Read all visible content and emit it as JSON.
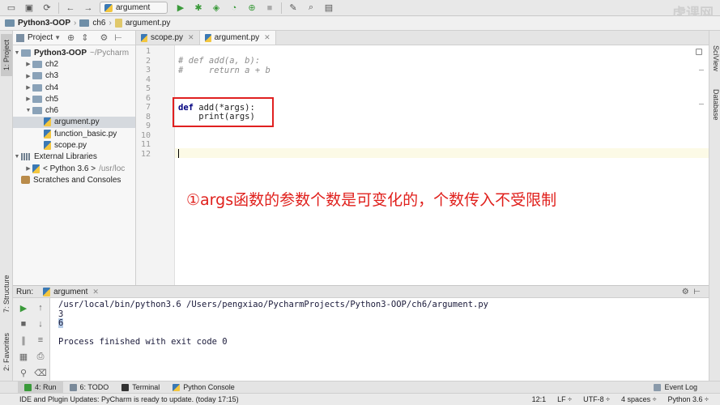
{
  "toolbar": {
    "run_config": "argument",
    "watermark": "虎课网"
  },
  "breadcrumb": [
    "Python3-OOP",
    "ch6",
    "argument.py"
  ],
  "left_strip": {
    "project_tab": "1: Project",
    "structure_tab": "7: Structure",
    "favorites_tab": "2: Favorites"
  },
  "right_strip": {
    "sciview_tab": "SciView",
    "database_tab": "Database"
  },
  "project_panel": {
    "header": "Project",
    "root_name": "Python3-OOP",
    "root_path": "~/Pycharm",
    "folders": [
      "ch2",
      "ch3",
      "ch4",
      "ch5",
      "ch6"
    ],
    "files": [
      "argument.py",
      "function_basic.py",
      "scope.py"
    ],
    "external_libraries": "External Libraries",
    "python_sdk": "< Python 3.6 >",
    "python_sdk_path": "/usr/loc",
    "scratches": "Scratches and Consoles"
  },
  "editor_tabs": [
    {
      "label": "scope.py"
    },
    {
      "label": "argument.py"
    }
  ],
  "editor": {
    "line_numbers": [
      "1",
      "2",
      "3",
      "4",
      "5",
      "6",
      "7",
      "8",
      "9",
      "10",
      "11",
      "12"
    ],
    "line2": "# def add(a, b):",
    "line3": "#     return a + b",
    "line7_kw": "def",
    "line7_rest": " add(*args):",
    "line8": "    print(args)",
    "annotation": "①args函数的参数个数是可变化的，个数传入不受限制"
  },
  "run_panel": {
    "label": "Run:",
    "config_tab": "argument",
    "console_lines": [
      "/usr/local/bin/python3.6 /Users/pengxiao/PycharmProjects/Python3-OOP/ch6/argument.py",
      "3",
      "6",
      "",
      "Process finished with exit code 0"
    ]
  },
  "bottom_tabs": {
    "run": "4: Run",
    "todo": "6: TODO",
    "terminal": "Terminal",
    "python_console": "Python Console",
    "event_log": "Event Log"
  },
  "status_bar": {
    "message": "IDE and Plugin Updates: PyCharm is ready to update. (today 17:15)",
    "position": "12:1",
    "line_sep": "LF ÷",
    "encoding": "UTF-8 ÷",
    "indent": "4 spaces ÷",
    "interpreter": "Python 3.6 ÷"
  }
}
